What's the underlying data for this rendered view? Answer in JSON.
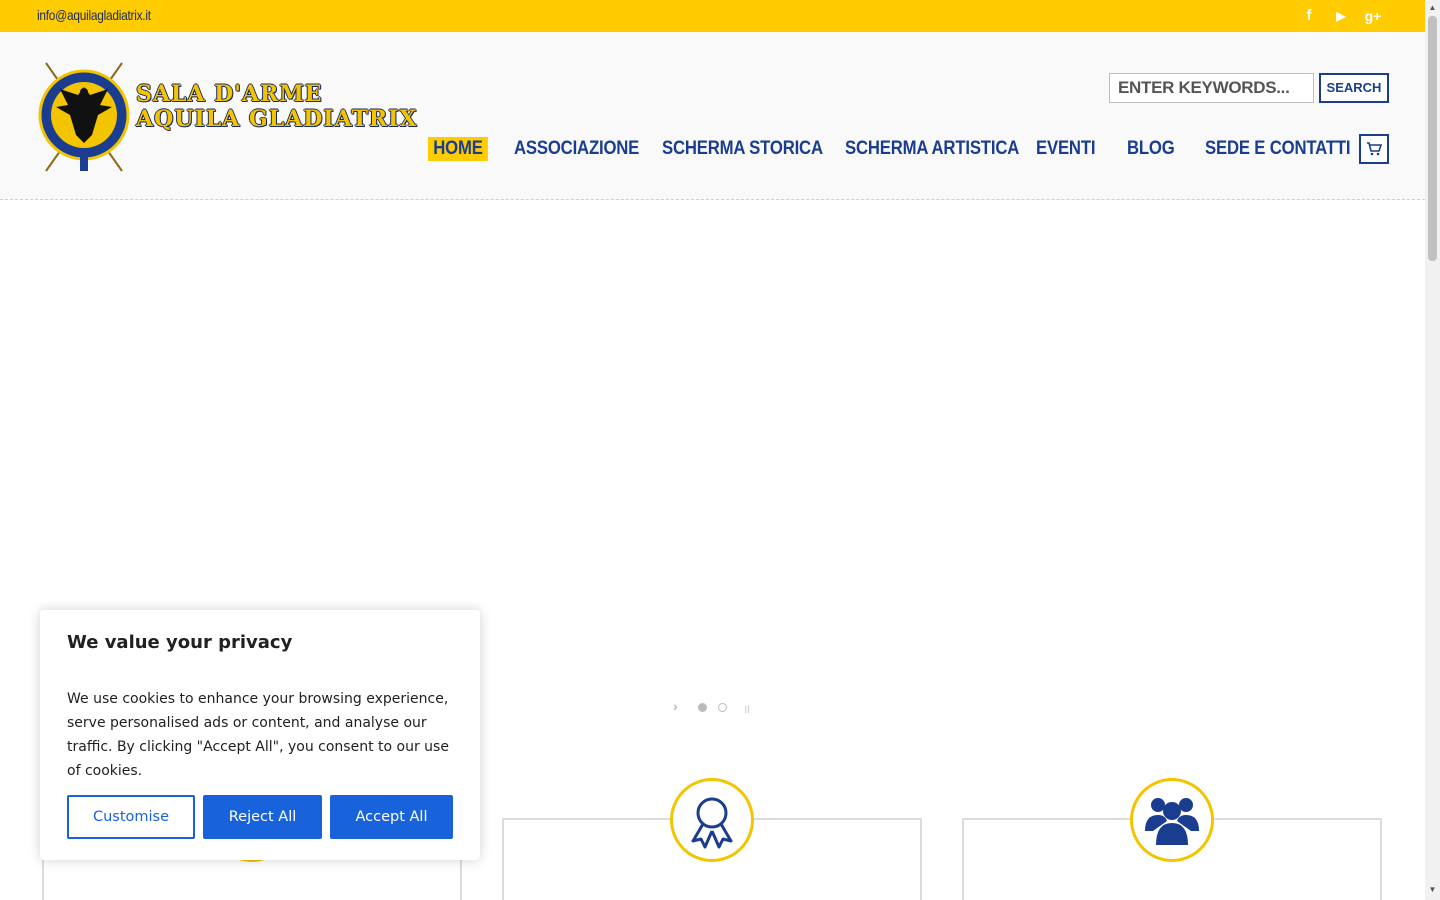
{
  "topbar": {
    "email": "info@aquilagladiatrix.it",
    "social": [
      {
        "icon": "facebook-icon",
        "glyph": "f"
      },
      {
        "icon": "youtube-icon",
        "glyph": "▶"
      },
      {
        "icon": "google-plus-icon",
        "glyph": "g+"
      }
    ],
    "bg_color": "#ffcc00"
  },
  "logo": {
    "line1": "SALA D'ARME",
    "line2": "AQUILA GLADIATRIX"
  },
  "search": {
    "placeholder": "ENTER KEYWORDS...",
    "button_label": "SEARCH"
  },
  "nav": {
    "items": [
      {
        "label": "HOME",
        "active": true
      },
      {
        "label": "ASSOCIAZIONE"
      },
      {
        "label": "SCHERMA STORICA"
      },
      {
        "label": "SCHERMA ARTISTICA"
      },
      {
        "label": "EVENTI"
      },
      {
        "label": "BLOG"
      },
      {
        "label": "SEDE E CONTATTI"
      }
    ],
    "cart_icon": "cart-icon",
    "accent_color": "#1a3d8f"
  },
  "slider": {
    "slide_count": 2,
    "active_slide": 1
  },
  "features": [
    {
      "icon": "award-ribbon-icon"
    },
    {
      "icon": "group-users-icon"
    }
  ],
  "cookie": {
    "title": "We value your privacy",
    "text": "We use cookies to enhance your browsing experience, serve personalised ads or content, and analyse our traffic. By clicking \"Accept All\", you consent to our use of cookies.",
    "customise_label": "Customise",
    "reject_label": "Reject All",
    "accept_label": "Accept All",
    "button_color": "#1863dc"
  }
}
